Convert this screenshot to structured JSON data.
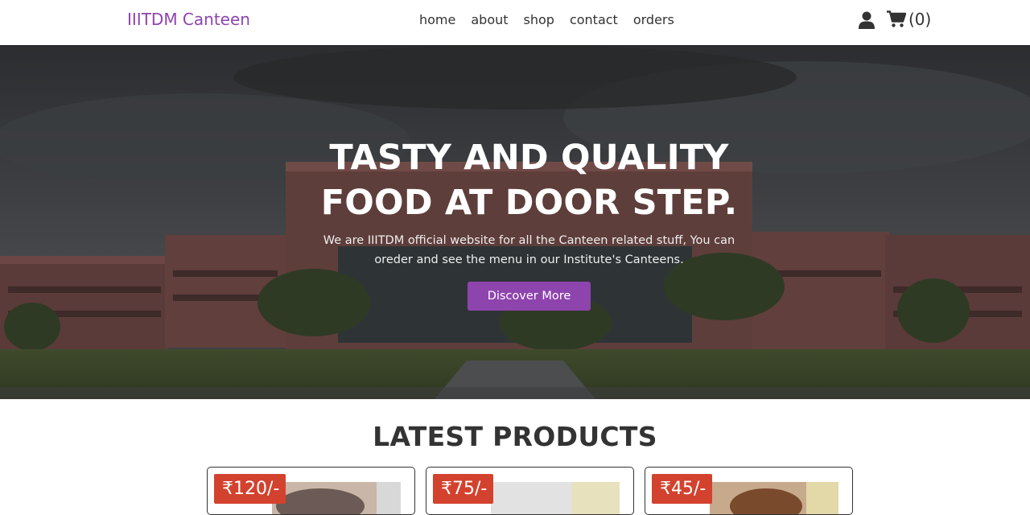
{
  "header": {
    "logo": "IIITDM Canteen",
    "nav": [
      "home",
      "about",
      "shop",
      "contact",
      "orders"
    ],
    "cart_count": "(0)"
  },
  "hero": {
    "title": "TASTY AND QUALITY FOOD AT DOOR STEP.",
    "text": "We are IIITDM official website for all the Canteen related stuff, You can oreder and see the menu in our Institute's Canteens.",
    "button": "Discover More"
  },
  "products": {
    "heading": "LATEST PRODUCTS",
    "items": [
      {
        "price": "₹120/-"
      },
      {
        "price": "₹75/-"
      },
      {
        "price": "₹45/-"
      }
    ]
  },
  "colors": {
    "accent": "#8e44ad",
    "price_badge": "#d3422e"
  }
}
